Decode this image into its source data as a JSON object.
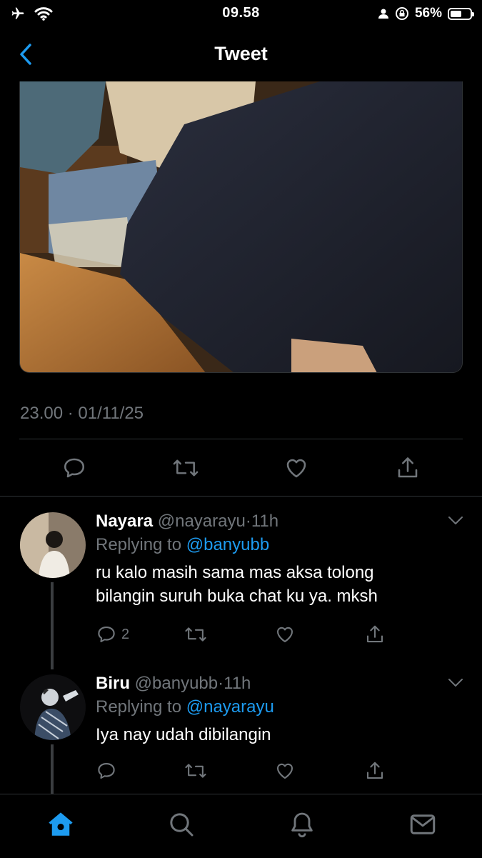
{
  "status_bar": {
    "time": "09.58",
    "battery": "56%"
  },
  "nav": {
    "title": "Tweet"
  },
  "tweet": {
    "timestamp": "23.00 · 01/11/25"
  },
  "replies": [
    {
      "name": "Nayara",
      "handle": "@nayarayu",
      "dot": "·",
      "time": "11h",
      "replying_label": "Replying to",
      "replying_to": "@banyubb",
      "text_line1": "ru kalo masih sama mas aksa tolong",
      "text_line2": "bilangin suruh buka chat ku ya. mksh",
      "reply_count": "2"
    },
    {
      "name": "Biru",
      "handle": "@banyubb",
      "dot": "·",
      "time": "11h",
      "replying_label": "Replying to",
      "replying_to": "@nayarayu",
      "text_line1": "Iya nay udah dibilangin",
      "reply_count": ""
    }
  ],
  "colors": {
    "accent": "#1d9bf0",
    "muted": "#71767b",
    "background": "#000000",
    "divider": "#2f3336"
  },
  "icons": [
    "back-chevron-icon",
    "reply-icon",
    "retweet-icon",
    "like-icon",
    "share-icon",
    "home-icon",
    "search-icon",
    "notifications-icon",
    "messages-icon"
  ]
}
